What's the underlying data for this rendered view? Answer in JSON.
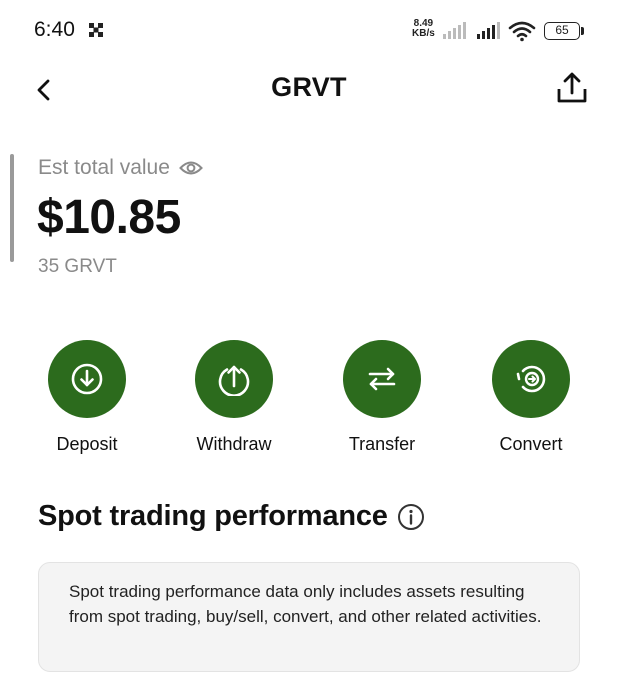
{
  "status_bar": {
    "time": "6:40",
    "net_speed_value": "8.49",
    "net_speed_unit": "KB/s",
    "battery": "65",
    "icons": [
      "notification-icon",
      "signal-icon",
      "signal-icon",
      "wifi-icon",
      "battery-icon"
    ]
  },
  "header": {
    "title": "GRVT",
    "back_icon": "chevron-left-icon",
    "share_icon": "share-icon"
  },
  "balance": {
    "label": "Est total value",
    "amount": "$10.85",
    "quantity": "35 GRVT",
    "visibility_icon": "eye-icon"
  },
  "actions": [
    {
      "label": "Deposit",
      "icon": "arrow-down-circle-icon"
    },
    {
      "label": "Withdraw",
      "icon": "arrow-up-circle-icon"
    },
    {
      "label": "Transfer",
      "icon": "swap-arrows-icon"
    },
    {
      "label": "Convert",
      "icon": "convert-icon"
    }
  ],
  "spot_performance": {
    "title": "Spot trading performance",
    "info_icon": "info-icon",
    "note": "Spot trading performance data only includes assets resulting from spot trading, buy/sell, convert, and other related activities."
  },
  "colors": {
    "accent_green": "#2c6b1d",
    "muted_text": "#8a8a8a",
    "card_bg": "#f4f4f4"
  }
}
